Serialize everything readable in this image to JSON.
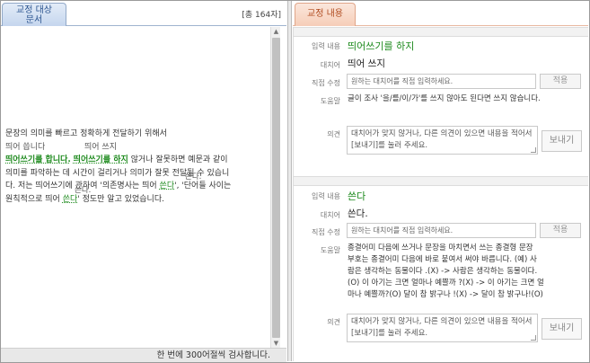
{
  "left_panel": {
    "tab_label": "교정 대상\n문서",
    "char_count": "[총 164자]",
    "footer": "한 번에 300어절씩 검사합니다."
  },
  "document": {
    "hints": {
      "line2_a": "띄어 씁니다",
      "line2_b": "띄어 쓰지",
      "line5": "쓴다.",
      "line6": "쓴다."
    },
    "line1": "문장의 의미를 빠르고 정확하게 전달하기 위해서",
    "line3": {
      "g1": "띄어쓰기를 합니다.",
      "g2": "띄어쓰기를 하지",
      "rest": " 않거나 잘못하면 예문과 같이"
    },
    "line4": "의미를 파악하는 데 시간이 걸리거나 의미가 잘못 전달될 수 있습니",
    "line5": {
      "a": "다. 저는 띄어쓰기에 관하여 '의존명사는 띄어 ",
      "g": "쓴다",
      "b": "', '단어들 사이는"
    },
    "line6": {
      "a": "원칙적으로 띄어 ",
      "g": "쓴다",
      "b": "' 정도만 알고 있었습니다."
    }
  },
  "right_panel": {
    "tab_label": "교정 내용",
    "labels": {
      "input": "입력 내용",
      "suggestion": "대치어",
      "manual": "직접 수정",
      "help": "도움말",
      "opinion": "의견"
    },
    "manual_placeholder": "원하는 대치어를 직접 입력하세요.",
    "apply_label": "적용",
    "opinion_placeholder": "대치어가 맞지 않거나, 다른 의견이 있으면 내용을 적어서 [보내기]를 눌러 주세요.",
    "send_label": "보내기",
    "items": [
      {
        "input": "띄어쓰기를 하지",
        "suggestion": "띄어 쓰지",
        "help": "글이 조사 '을/를/이/가'를 쓰지 않아도 된다면 쓰지 않습니다."
      },
      {
        "input": "쓴다",
        "suggestion": "쓴다.",
        "help": "종결어미 다음에 쓰거나 문장을 마치면서 쓰는 종결형 문장\n부호는 종결어미 다음에 바로 붙여서 써야 바릅니다. (예) 사\n람은 생각하는 동물이다 .(X) -> 사람은 생각하는 동물이다.\n(O) 이 아기는 크면 얼마나 예쁠까 ?(X) -> 이 아기는 크면 얼\n마나 예쁠까?(O) 달이 참 밝구나 !(X) -> 달이 참 밝구나!(O)"
      }
    ]
  }
}
